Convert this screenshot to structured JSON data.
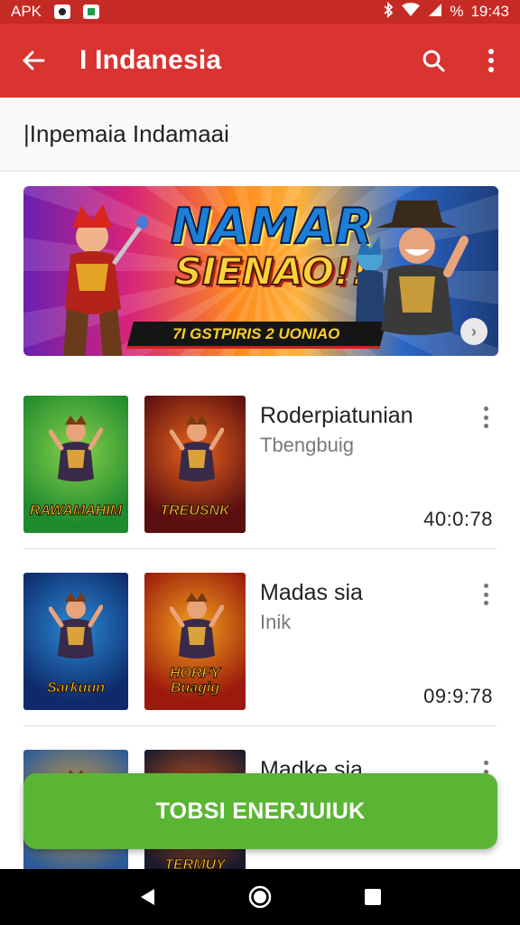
{
  "status_bar": {
    "carrier": "APK",
    "battery": "%",
    "time": "19:43"
  },
  "app_bar": {
    "title": "I Indanesia",
    "back_icon": "arrow-left-icon",
    "search_icon": "search-icon",
    "menu_icon": "more-vert-icon"
  },
  "section": {
    "title": "|Inpemaia Indamaai"
  },
  "banner": {
    "headline_1": "NAMAR",
    "headline_2": "SIENAO!!",
    "ribbon": "7I GSTPIRIS 2 UONIAO"
  },
  "items": [
    {
      "name": "Roderpiatunian",
      "subtitle": "Tbengbuig",
      "duration": "40:0:78",
      "thumb1_caption": "RAWAMAHIM",
      "thumb2_caption": "TREUSNK",
      "thumb1_colors": [
        "#1e8a2e",
        "#8ad14a"
      ],
      "thumb2_colors": [
        "#5a0f10",
        "#e8631c"
      ]
    },
    {
      "name": "Madas sia",
      "subtitle": "Inik",
      "duration": "09:9:78",
      "thumb1_caption": "Sarkuun",
      "thumb2_caption": "HORFY Buagig",
      "thumb1_colors": [
        "#0e2a6b",
        "#2a8ad6"
      ],
      "thumb2_colors": [
        "#9b1a0c",
        "#f2a21c"
      ]
    },
    {
      "name": "Madke sia",
      "subtitle": "",
      "duration": "",
      "thumb1_caption": "",
      "thumb2_caption": "TERMUY",
      "thumb1_colors": [
        "#2b5a9a",
        "#e0a43a"
      ],
      "thumb2_colors": [
        "#1a1a2e",
        "#d85a1c"
      ]
    }
  ],
  "cta": {
    "label": "TOBSI ENERJUIUK"
  },
  "nav": {
    "back_icon": "nav-back-icon",
    "home_icon": "nav-home-icon",
    "recents_icon": "nav-recents-icon"
  },
  "colors": {
    "primary": "#d93430",
    "status": "#c62a24",
    "cta": "#5bb534"
  }
}
